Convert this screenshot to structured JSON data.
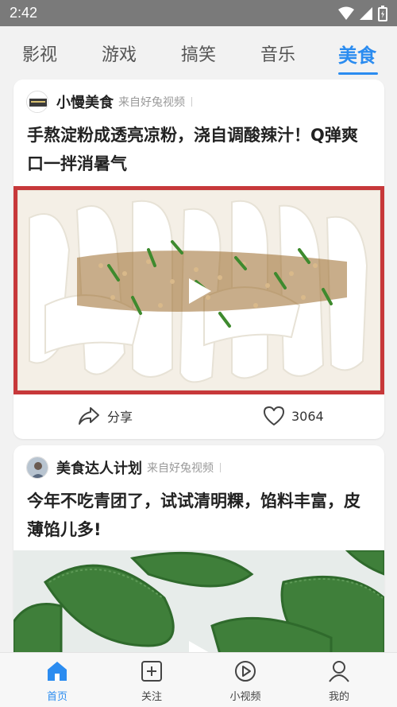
{
  "status_bar": {
    "time": "2:42"
  },
  "tabs": [
    {
      "label": "影视",
      "active": false
    },
    {
      "label": "游戏",
      "active": false
    },
    {
      "label": "搞笑",
      "active": false
    },
    {
      "label": "音乐",
      "active": false
    },
    {
      "label": "美食",
      "active": true
    }
  ],
  "feed": [
    {
      "author": "小慢美食",
      "source": "来自好兔视频",
      "title": "手熬淀粉成透亮凉粉，浇自调酸辣汁！Q弹爽口一拌消暑气",
      "share_label": "分享",
      "likes": "3064"
    },
    {
      "author": "美食达人计划",
      "source": "来自好兔视频",
      "title": "今年不吃青团了，试试清明粿，馅料丰富，皮薄馅儿多!"
    }
  ],
  "bottom_nav": [
    {
      "label": "首页",
      "icon": "home-icon",
      "active": true
    },
    {
      "label": "关注",
      "icon": "follow-plus-icon",
      "active": false
    },
    {
      "label": "小视频",
      "icon": "play-circle-icon",
      "active": false
    },
    {
      "label": "我的",
      "icon": "user-icon",
      "active": false
    }
  ],
  "colors": {
    "accent": "#2b8cf0",
    "status_bar": "#7a7a7a"
  }
}
